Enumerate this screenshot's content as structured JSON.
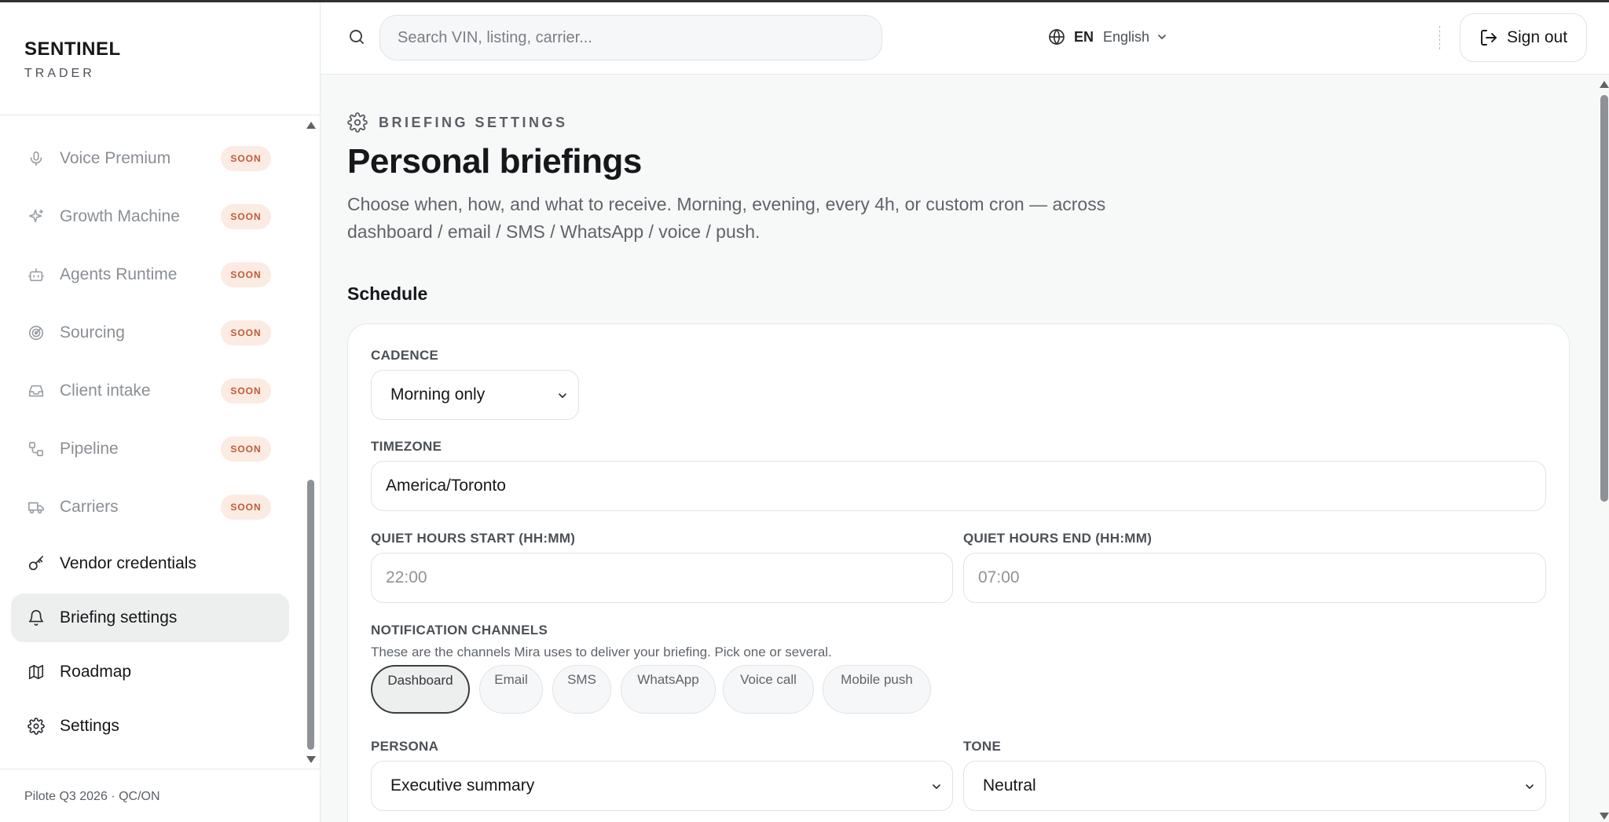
{
  "brand": {
    "name": "SENTINEL",
    "sub": "TRADER"
  },
  "sidebar": {
    "items": [
      {
        "label": "Voice Premium",
        "badge": "SOON",
        "icon": "microphone-icon"
      },
      {
        "label": "Growth Machine",
        "badge": "SOON",
        "icon": "sparkles-icon"
      },
      {
        "label": "Agents Runtime",
        "badge": "SOON",
        "icon": "bot-icon"
      },
      {
        "label": "Sourcing",
        "badge": "SOON",
        "icon": "radar-icon"
      },
      {
        "label": "Client intake",
        "badge": "SOON",
        "icon": "inbox-icon"
      },
      {
        "label": "Pipeline",
        "badge": "SOON",
        "icon": "workflow-icon"
      },
      {
        "label": "Carriers",
        "badge": "SOON",
        "icon": "truck-icon"
      },
      {
        "label": "Vendor credentials",
        "icon": "key-icon"
      },
      {
        "label": "Briefing settings",
        "icon": "bell-icon",
        "selected": true
      },
      {
        "label": "Roadmap",
        "icon": "map-icon"
      },
      {
        "label": "Settings",
        "icon": "gear-icon"
      }
    ],
    "footer": "Pilote Q3 2026 · QC/ON"
  },
  "header": {
    "search_placeholder": "Search VIN, listing, carrier...",
    "lang_code": "EN",
    "lang_name": "English",
    "sign_out": "Sign out"
  },
  "main": {
    "eyebrow": "BRIEFING SETTINGS",
    "title": "Personal briefings",
    "description": "Choose when, how, and what to receive. Morning, evening, every 4h, or custom cron — across dashboard / email / SMS / WhatsApp / voice / push.",
    "section_title": "Schedule",
    "form": {
      "cadence_label": "CADENCE",
      "cadence_value": "Morning only",
      "timezone_label": "TIMEZONE",
      "timezone_value": "America/Toronto",
      "quiet_start_label": "QUIET HOURS START (HH:MM)",
      "quiet_start_placeholder": "22:00",
      "quiet_end_label": "QUIET HOURS END (HH:MM)",
      "quiet_end_placeholder": "07:00",
      "channels_label": "NOTIFICATION CHANNELS",
      "channels_helper": "These are the channels Mira uses to deliver your briefing. Pick one or several.",
      "channels": [
        {
          "label": "Dashboard",
          "selected": true
        },
        {
          "label": "Email",
          "selected": false
        },
        {
          "label": "SMS",
          "selected": false
        },
        {
          "label": "WhatsApp",
          "selected": false
        },
        {
          "label": "Voice call",
          "selected": false
        },
        {
          "label": "Mobile push",
          "selected": false
        }
      ],
      "persona_label": "PERSONA",
      "persona_value": "Executive summary",
      "tone_label": "TONE",
      "tone_value": "Neutral"
    }
  },
  "colors": {
    "soon_badge_bg": "#fcebe3",
    "soon_badge_text": "#c05a37",
    "selected_nav_bg": "#ecefee"
  }
}
